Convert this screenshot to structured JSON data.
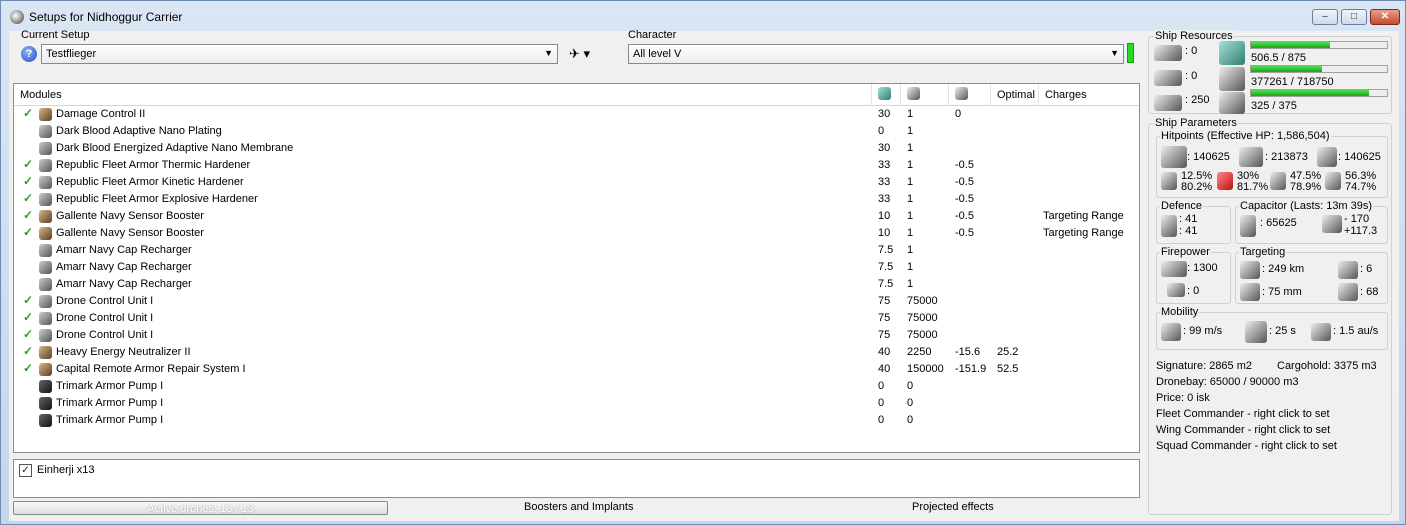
{
  "window": {
    "title": "Setups for Nidhoggur Carrier"
  },
  "setup": {
    "label": "Current Setup",
    "value": "Testflieger"
  },
  "character": {
    "label": "Character",
    "value": "All level V"
  },
  "modules": {
    "headers": {
      "name": "Modules",
      "optimal": "Optimal",
      "charges": "Charges"
    },
    "rows": [
      {
        "check": true,
        "name": "Damage Control II",
        "cpu": "30",
        "pg": "1",
        "cap": "0",
        "optimal": "",
        "charges": "",
        "icon": "brown"
      },
      {
        "check": false,
        "name": "Dark Blood Adaptive Nano Plating",
        "cpu": "0",
        "pg": "1",
        "cap": "",
        "optimal": "",
        "charges": "",
        "icon": "gray"
      },
      {
        "check": false,
        "name": "Dark Blood Energized Adaptive Nano Membrane",
        "cpu": "30",
        "pg": "1",
        "cap": "",
        "optimal": "",
        "charges": "",
        "icon": "gray"
      },
      {
        "check": true,
        "name": "Republic Fleet Armor Thermic Hardener",
        "cpu": "33",
        "pg": "1",
        "cap": "-0.5",
        "optimal": "",
        "charges": "",
        "icon": "gray"
      },
      {
        "check": true,
        "name": "Republic Fleet Armor Kinetic Hardener",
        "cpu": "33",
        "pg": "1",
        "cap": "-0.5",
        "optimal": "",
        "charges": "",
        "icon": "gray"
      },
      {
        "check": true,
        "name": "Republic Fleet Armor Explosive Hardener",
        "cpu": "33",
        "pg": "1",
        "cap": "-0.5",
        "optimal": "",
        "charges": "",
        "icon": "gray"
      },
      {
        "check": true,
        "name": "Gallente Navy Sensor Booster",
        "cpu": "10",
        "pg": "1",
        "cap": "-0.5",
        "optimal": "",
        "charges": "Targeting Range",
        "icon": "brown"
      },
      {
        "check": true,
        "name": "Gallente Navy Sensor Booster",
        "cpu": "10",
        "pg": "1",
        "cap": "-0.5",
        "optimal": "",
        "charges": "Targeting Range",
        "icon": "brown"
      },
      {
        "check": false,
        "name": "Amarr Navy Cap Recharger",
        "cpu": "7.5",
        "pg": "1",
        "cap": "",
        "optimal": "",
        "charges": "",
        "icon": "gray"
      },
      {
        "check": false,
        "name": "Amarr Navy Cap Recharger",
        "cpu": "7.5",
        "pg": "1",
        "cap": "",
        "optimal": "",
        "charges": "",
        "icon": "gray"
      },
      {
        "check": false,
        "name": "Amarr Navy Cap Recharger",
        "cpu": "7.5",
        "pg": "1",
        "cap": "",
        "optimal": "",
        "charges": "",
        "icon": "gray"
      },
      {
        "check": true,
        "name": "Drone Control Unit I",
        "cpu": "75",
        "pg": "75000",
        "cap": "",
        "optimal": "",
        "charges": "",
        "icon": "gray"
      },
      {
        "check": true,
        "name": "Drone Control Unit I",
        "cpu": "75",
        "pg": "75000",
        "cap": "",
        "optimal": "",
        "charges": "",
        "icon": "gray"
      },
      {
        "check": true,
        "name": "Drone Control Unit I",
        "cpu": "75",
        "pg": "75000",
        "cap": "",
        "optimal": "",
        "charges": "",
        "icon": "gray"
      },
      {
        "check": true,
        "name": "Heavy Energy Neutralizer II",
        "cpu": "40",
        "pg": "2250",
        "cap": "-15.6",
        "optimal": "25.2",
        "charges": "",
        "icon": "brown"
      },
      {
        "check": true,
        "name": "Capital Remote Armor Repair System I",
        "cpu": "40",
        "pg": "150000",
        "cap": "-151.9",
        "optimal": "52.5",
        "charges": "",
        "icon": "brown"
      },
      {
        "check": false,
        "name": "Trimark Armor Pump I",
        "cpu": "0",
        "pg": "0",
        "cap": "",
        "optimal": "",
        "charges": "",
        "icon": "dark"
      },
      {
        "check": false,
        "name": "Trimark Armor Pump I",
        "cpu": "0",
        "pg": "0",
        "cap": "",
        "optimal": "",
        "charges": "",
        "icon": "dark"
      },
      {
        "check": false,
        "name": "Trimark Armor Pump I",
        "cpu": "0",
        "pg": "0",
        "cap": "",
        "optimal": "",
        "charges": "",
        "icon": "dark"
      }
    ]
  },
  "drones": {
    "item": "Einherji x13",
    "checked": true
  },
  "bottom": {
    "active_drones": "Active drones: 13 / 13",
    "boosters": "Boosters and Implants",
    "projected": "Projected effects"
  },
  "resources": {
    "title": "Ship Resources",
    "hi": ": 0",
    "med": ": 0",
    "low": ": 250",
    "cpu": "506.5 / 875",
    "cpu_fraction": 0.58,
    "pg": "377261 / 718750",
    "pg_fraction": 0.52,
    "cal": "325 / 375",
    "cal_fraction": 0.87
  },
  "params": {
    "title": "Ship Parameters",
    "hp_title": "Hitpoints (Effective HP: 1,586,504)",
    "shield_hp": ": 140625",
    "armor_hp": ": 213873",
    "hull_hp": ": 140625",
    "em": [
      "12.5%",
      "80.2%"
    ],
    "therm": [
      "30%",
      "81.7%"
    ],
    "kin": [
      "47.5%",
      "78.9%"
    ],
    "exp": [
      "56.3%",
      "74.7%"
    ],
    "defence_title": "Defence",
    "def1": ": 41",
    "def2": ": 41",
    "cap_title": "Capacitor (Lasts: 13m 39s)",
    "cap_amount": ": 65625",
    "cap_delta1": "- 170",
    "cap_delta2": "+117.3",
    "firepower_title": "Firepower",
    "fp1": ": 1300",
    "fp2": ": 0",
    "targeting_title": "Targeting",
    "range": ": 249 km",
    "targets": ": 6",
    "scanres": ": 75 mm",
    "sensor": ": 68",
    "mobility_title": "Mobility",
    "speed": ": 99 m/s",
    "align": ": 25 s",
    "warp": ": 1.5 au/s",
    "signature": "Signature: 2865 m2",
    "cargo": "Cargohold: 3375 m3",
    "dronebay": "Dronebay: 65000 / 90000 m3",
    "price": "Price: 0 isk",
    "fleet": "Fleet Commander - right click to set",
    "wing": "Wing Commander - right click to set",
    "squad": "Squad Commander - right click to set"
  },
  "colors": {
    "accent_green": "#22dd22"
  }
}
